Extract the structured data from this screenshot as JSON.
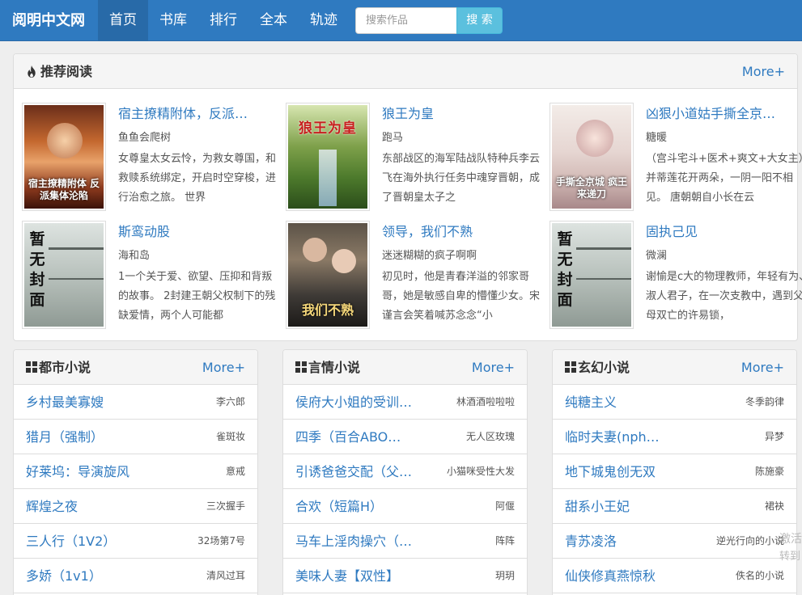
{
  "nav": {
    "brand": "阅明中文网",
    "items": [
      {
        "label": "首页",
        "active": true
      },
      {
        "label": "书库"
      },
      {
        "label": "排行"
      },
      {
        "label": "全本"
      },
      {
        "label": "轨迹"
      }
    ],
    "search_placeholder": "搜索作品",
    "search_button": "搜 索"
  },
  "recommend": {
    "title": "推荐阅读",
    "more": "More+",
    "books": [
      {
        "title": "宿主撩精附体，反派…",
        "author": "鱼鱼会爬树",
        "desc": "女尊皇太女云怜，为救女尊国，和救赎系统绑定，开启时空穿梭，进行治愈之旅。 世界",
        "cover_text": "宿主撩精附体 反派集体沦陷"
      },
      {
        "title": "狼王为皇",
        "author": "跑马",
        "desc": "东部战区的海军陆战队特种兵李云飞在海外执行任务中魂穿晋朝，成了晋朝皇太子之",
        "cover_text": "狼王为皇"
      },
      {
        "title": "凶狠小道姑手撕全京…",
        "author": "糖暖",
        "desc": "（宫斗宅斗+医术+爽文+大女主） 并蒂莲花开两朵，一阴一阳不相见。 唐朝朝自小长在云",
        "cover_text": "手撕全京城 疯王来递刀"
      },
      {
        "title": "斯鸾动股",
        "author": "海和岛",
        "desc": "1一个关于爱、欲望、压抑和背叛的故事。 2封建王朝父权制下的残缺爱情，两个人可能都",
        "cover_text": "暂无封面"
      },
      {
        "title": "领导，我们不熟",
        "author": "迷迷糊糊的疯子啊啊",
        "desc": "初见时，他是青春洋溢的邻家哥哥，她是敏感自卑的懵懂少女。宋谨言会笑着喊苏念念“小",
        "cover_text": "我们不熟"
      },
      {
        "title": "固执己见",
        "author": "微澜",
        "desc": "谢愉是c大的物理教师，年轻有为、淑人君子，在一次支教中，遇到父母双亡的许易锁，",
        "cover_text": "暂无封面"
      }
    ]
  },
  "columns": [
    {
      "title": "都市小说",
      "more": "More+",
      "items": [
        {
          "title": "乡村最美寡嫂",
          "author": "李六郎"
        },
        {
          "title": "猎月（强制）",
          "author": "雀斑妆"
        },
        {
          "title": "好莱坞：导演旋风",
          "author": "意戒"
        },
        {
          "title": "辉煌之夜",
          "author": "三次握手"
        },
        {
          "title": "三人行（1V2）",
          "author": "32场第7号"
        },
        {
          "title": "多娇（1v1）",
          "author": "清风过耳"
        }
      ]
    },
    {
      "title": "言情小说",
      "more": "More+",
      "items": [
        {
          "title": "侯府大小姐的受训…",
          "author": "林酒酒啦啦啦"
        },
        {
          "title": "四季（百合ABO…",
          "author": "无人区玫瑰"
        },
        {
          "title": "引诱爸爸交配（父…",
          "author": "小猫咪受性大发"
        },
        {
          "title": "合欢（短篇H）",
          "author": "阿偃"
        },
        {
          "title": "马车上淫肉操穴（…",
          "author": "阵阵"
        },
        {
          "title": "美味人妻【双性】",
          "author": "玥玥"
        }
      ]
    },
    {
      "title": "玄幻小说",
      "more": "More+",
      "items": [
        {
          "title": "纯糖主义",
          "author": "冬季韵律"
        },
        {
          "title": "临时夫妻(nph…",
          "author": "异梦"
        },
        {
          "title": "地下城鬼创无双",
          "author": "陈施豪"
        },
        {
          "title": "甜系小王妃",
          "author": "裙袂"
        },
        {
          "title": "青苏凌洛",
          "author": "逆光行向的小说"
        },
        {
          "title": "仙侠修真燕惊秋",
          "author": "佚名的小说"
        }
      ]
    }
  ],
  "watermark": [
    "激活",
    "转到"
  ],
  "colors": {
    "nav": "#2f7ac0",
    "link": "#2f7ac0",
    "search_button": "#5bc0de"
  }
}
